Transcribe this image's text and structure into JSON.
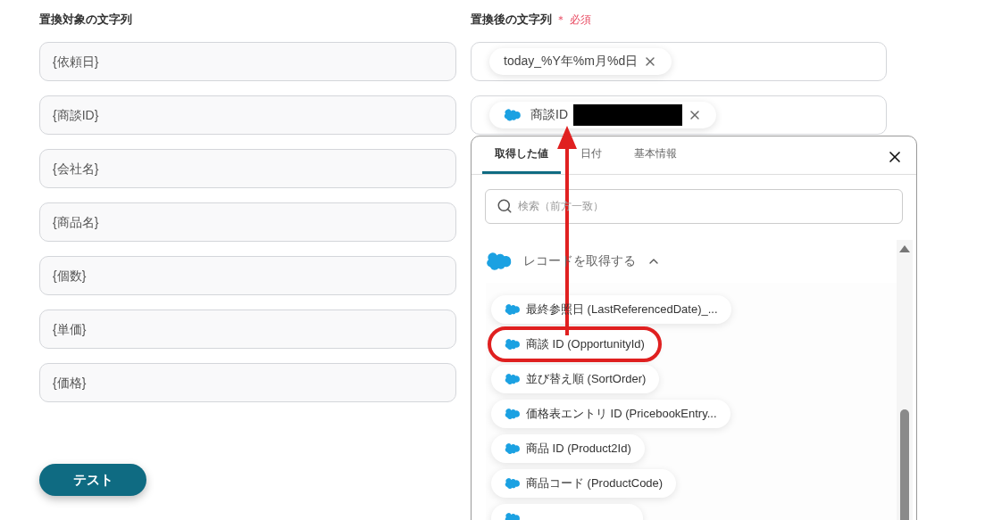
{
  "source": {
    "label": "置換対象の文字列",
    "fields": [
      {
        "value": "{依頼日}"
      },
      {
        "value": "{商談ID}"
      },
      {
        "value": "{会社名}"
      },
      {
        "value": "{商品名}"
      },
      {
        "value": "{個数}"
      },
      {
        "value": "{単価}"
      },
      {
        "value": "{価格}"
      }
    ]
  },
  "test_button": "テスト",
  "target": {
    "label": "置換後の文字列",
    "required_mark": "＊",
    "required": "必須",
    "fields": [
      {
        "chips": [
          {
            "kind": "plain",
            "text": "today_%Y年%m月%d日",
            "redacted": false
          }
        ]
      },
      {
        "chips": [
          {
            "kind": "salesforce",
            "text": "商談ID",
            "redacted": true
          }
        ]
      }
    ]
  },
  "picker": {
    "tabs": [
      {
        "label": "取得した値",
        "selected": true
      },
      {
        "label": "日付",
        "selected": false
      },
      {
        "label": "基本情報",
        "selected": false
      }
    ],
    "search": {
      "placeholder": "検索（前方一致）"
    },
    "group": {
      "title": "レコードを取得する",
      "expanded": true
    },
    "items": [
      {
        "text": "最終参照日 (LastReferencedDate)_...",
        "highlighted": false
      },
      {
        "text": "商談 ID (OpportunityId)",
        "highlighted": true
      },
      {
        "text": "並び替え順 (SortOrder)",
        "highlighted": false
      },
      {
        "text": "価格表エントリ ID (PricebookEntry...",
        "highlighted": false
      },
      {
        "text": "商品 ID (Product2Id)",
        "highlighted": false
      },
      {
        "text": "商品コード (ProductCode)",
        "highlighted": false
      }
    ]
  }
}
